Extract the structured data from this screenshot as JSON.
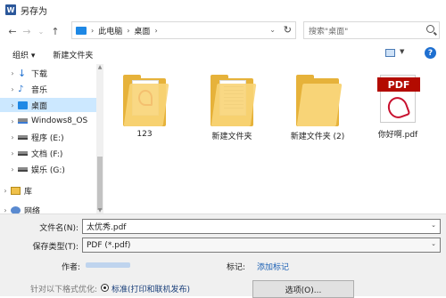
{
  "window": {
    "title": "另存为",
    "app_icon_letter": "W"
  },
  "address_bar": {
    "breadcrumbs": [
      "此电脑",
      "桌面"
    ],
    "search_placeholder": "搜索\"桌面\""
  },
  "toolbar": {
    "organize": "组织 ▾",
    "new_folder": "新建文件夹"
  },
  "sidebar": {
    "items": [
      {
        "label": "下载",
        "icon": "download-icon"
      },
      {
        "label": "音乐",
        "icon": "music-icon"
      },
      {
        "label": "桌面",
        "icon": "desktop-icon",
        "selected": true
      },
      {
        "label": "Windows8_OS",
        "icon": "drive-icon"
      },
      {
        "label": "程序 (E:)",
        "icon": "drive-icon"
      },
      {
        "label": "文档 (F:)",
        "icon": "drive-icon"
      },
      {
        "label": "娱乐 (G:)",
        "icon": "drive-icon"
      },
      {
        "label": "库",
        "icon": "library-icon"
      },
      {
        "label": "网络",
        "icon": "network-icon"
      }
    ]
  },
  "files": [
    {
      "name": "123",
      "type": "folder-pdf"
    },
    {
      "name": "新建文件夹",
      "type": "folder-doc"
    },
    {
      "name": "新建文件夹 (2)",
      "type": "folder"
    },
    {
      "name": "你好啊.pdf",
      "type": "pdf",
      "badge": "PDF"
    }
  ],
  "form": {
    "filename_label": "文件名(N):",
    "filename_value": "太优秀.pdf",
    "filetype_label": "保存类型(T):",
    "filetype_value": "PDF (*.pdf)",
    "author_label": "作者:",
    "tags_label": "标记:",
    "tags_link": "添加标记",
    "optimize_label": "针对以下格式优化:",
    "optimize_option": "标准(打印和联机发布)",
    "options_button": "选项(O)..."
  }
}
